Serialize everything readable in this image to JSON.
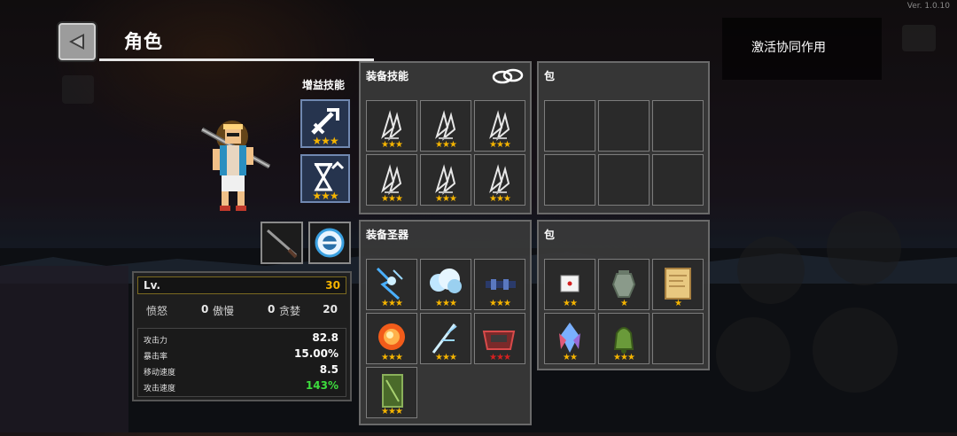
{
  "version": "Ver. 1.0.10",
  "header": {
    "title": "角色",
    "synergy_label": "激活协同作用"
  },
  "boost": {
    "label": "增益技能",
    "slots": [
      {
        "icon": "sword-upgrade-icon",
        "stars": "★★★"
      },
      {
        "icon": "hourglass-upgrade-icon",
        "stars": "★★★"
      }
    ]
  },
  "weapons": [
    {
      "icon": "katana-icon"
    },
    {
      "icon": "orb-shield-icon"
    }
  ],
  "stats": {
    "lv_label": "Lv.",
    "lv_value": "30",
    "sins": {
      "wrath_label": "愤怒",
      "wrath_value": "0",
      "pride_label": "傲慢",
      "pride_value": "0",
      "greed_label": "贪婪",
      "greed_value": "20"
    },
    "combat": [
      {
        "label": "攻击力",
        "value": "82.8",
        "color": "#ffffff"
      },
      {
        "label": "暴击率",
        "value": "15.00%",
        "color": "#ffffff"
      },
      {
        "label": "移动速度",
        "value": "8.5",
        "color": "#ffffff"
      },
      {
        "label": "攻击速度",
        "value": "143%",
        "color": "#3ddc3d"
      }
    ]
  },
  "skills_panel": {
    "title": "装备技能",
    "link_icon": "chain-link-icon",
    "slots": [
      {
        "icon": "claw-skill-icon",
        "stars": "★★★"
      },
      {
        "icon": "claw-skill-icon",
        "stars": "★★★"
      },
      {
        "icon": "claw-skill-icon",
        "stars": "★★★"
      },
      {
        "icon": "claw-skill-icon",
        "stars": "★★★"
      },
      {
        "icon": "claw-skill-icon",
        "stars": "★★★"
      },
      {
        "icon": "claw-skill-icon",
        "stars": "★★★"
      }
    ]
  },
  "skill_bag": {
    "title": "包"
  },
  "relics_panel": {
    "title": "装备圣器",
    "slots": [
      {
        "icon": "lightning-relic-icon",
        "stars": "★★★",
        "star_color": "gold"
      },
      {
        "icon": "cloud-relic-icon",
        "stars": "★★★",
        "star_color": "gold"
      },
      {
        "icon": "dark-bar-relic-icon",
        "stars": "★★★",
        "star_color": "gold"
      },
      {
        "icon": "fireball-relic-icon",
        "stars": "★★★",
        "star_color": "gold"
      },
      {
        "icon": "ice-branch-relic-icon",
        "stars": "★★★",
        "star_color": "gold"
      },
      {
        "icon": "red-altar-relic-icon",
        "stars": "★★★",
        "star_color": "red"
      },
      {
        "icon": "green-card-relic-icon",
        "stars": "★★★",
        "star_color": "gold"
      }
    ]
  },
  "relic_bag": {
    "title": "包",
    "slots": [
      {
        "icon": "dice-icon",
        "stars": "★★"
      },
      {
        "icon": "urn-icon",
        "stars": "★"
      },
      {
        "icon": "scroll-icon",
        "stars": "★"
      },
      {
        "icon": "crystal-icon",
        "stars": "★★"
      },
      {
        "icon": "green-bell-icon",
        "stars": "★★★"
      }
    ]
  }
}
